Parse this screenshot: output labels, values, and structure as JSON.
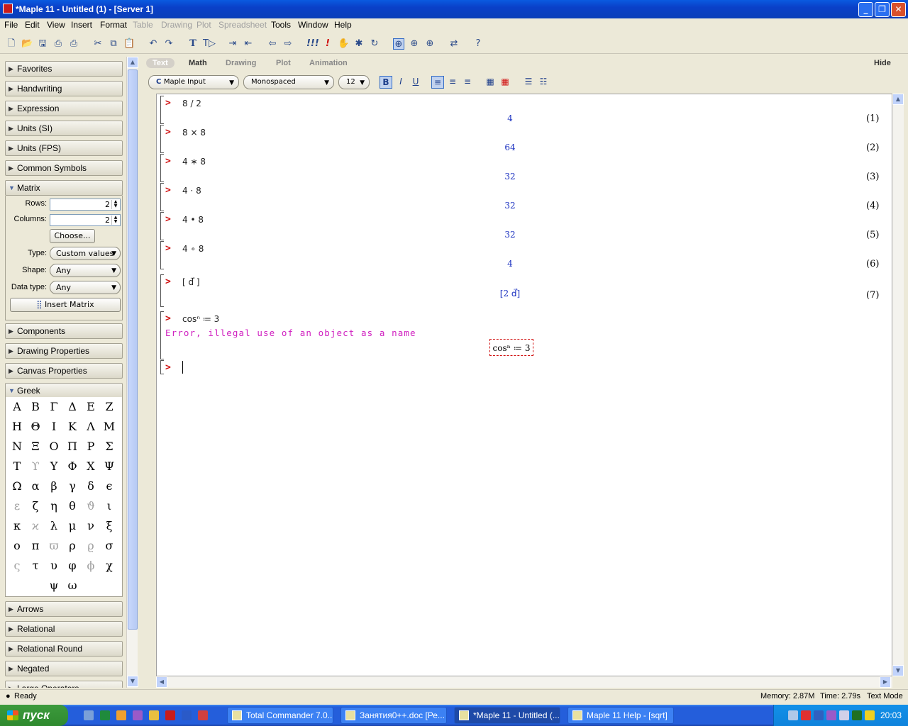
{
  "window": {
    "title": "*Maple 11 - Untitled (1) - [Server 1]"
  },
  "menu": [
    "File",
    "Edit",
    "View",
    "Insert",
    "Format",
    "Table",
    "Drawing",
    "Plot",
    "Spreadsheet",
    "Tools",
    "Window",
    "Help"
  ],
  "menu_disabled": [
    "Table",
    "Drawing",
    "Plot",
    "Spreadsheet"
  ],
  "palettes": {
    "collapsed_top": [
      "Favorites",
      "Handwriting",
      "Expression",
      "Units (SI)",
      "Units (FPS)",
      "Common Symbols"
    ],
    "matrix": {
      "title": "Matrix",
      "rows_label": "Rows:",
      "rows_value": "2",
      "columns_label": "Columns:",
      "columns_value": "2",
      "choose_button": "Choose...",
      "type_label": "Type:",
      "type_value": "Custom values",
      "shape_label": "Shape:",
      "shape_value": "Any",
      "datatype_label": "Data type:",
      "datatype_value": "Any",
      "insert_button": "Insert Matrix"
    },
    "collapsed_mid": [
      "Components",
      "Drawing Properties",
      "Canvas Properties"
    ],
    "greek": {
      "title": "Greek",
      "symbols": [
        "Α",
        "Β",
        "Γ",
        "Δ",
        "Ε",
        "Ζ",
        "Η",
        "Θ",
        "Ι",
        "Κ",
        "Λ",
        "Μ",
        "Ν",
        "Ξ",
        "Ο",
        "Π",
        "Ρ",
        "Σ",
        "Τ",
        "ϒ",
        "Υ",
        "Φ",
        "Χ",
        "Ψ",
        "Ω",
        "α",
        "β",
        "γ",
        "δ",
        "ϵ",
        "ε",
        "ζ",
        "η",
        "θ",
        "ϑ",
        "ι",
        "κ",
        "ϰ",
        "λ",
        "μ",
        "ν",
        "ξ",
        "ο",
        "π",
        "ϖ",
        "ρ",
        "ϱ",
        "σ",
        "ς",
        "τ",
        "υ",
        "φ",
        "ϕ",
        "χ",
        "ψ",
        "ω"
      ],
      "lite": [
        "ϒ",
        "ε",
        "ϑ",
        "ϰ",
        "ϖ",
        "ϱ",
        "ς",
        "ϕ"
      ]
    },
    "collapsed_bottom": [
      "Arrows",
      "Relational",
      "Relational Round",
      "Negated",
      "Large Operators"
    ]
  },
  "context_tabs": [
    "Text",
    "Math",
    "Drawing",
    "Plot",
    "Animation"
  ],
  "context_hide": "Hide",
  "format": {
    "input_mode": "Maple Input",
    "font": "Monospaced",
    "size": "12"
  },
  "worksheet": [
    {
      "input": "8 / 2",
      "output": "4",
      "label": "(1)"
    },
    {
      "input": "8 × 8",
      "output": "64",
      "label": "(2)"
    },
    {
      "input": "4 ∗ 8",
      "output": "32",
      "label": "(3)"
    },
    {
      "input": "4 · 8",
      "output": "32",
      "label": "(4)"
    },
    {
      "input": "4 • 8",
      "output": "32",
      "label": "(5)"
    },
    {
      "input": "4 ∘ 8",
      "output": "4",
      "label": "(6)"
    },
    {
      "input": "[ d⃗ ]",
      "output": "[2 d⃗]",
      "label": "(7)"
    }
  ],
  "error_input": "cosⁿ ≔ 3",
  "error_message": "Error, illegal use of an object as a name",
  "error_echo": "cosⁿ ≔ 3",
  "prompt_symbol": ">",
  "status": {
    "ready": "Ready",
    "memory": "Memory: 2.87M",
    "time": "Time: 2.79s",
    "mode": "Text Mode"
  },
  "taskbar": {
    "start": "пуск",
    "tasks": [
      "Total Commander 7.0...",
      "Занятия0++.doc [Ре...",
      "*Maple 11 - Untitled (...",
      "Maple 11 Help - [sqrt]"
    ],
    "clock": "20:03"
  }
}
